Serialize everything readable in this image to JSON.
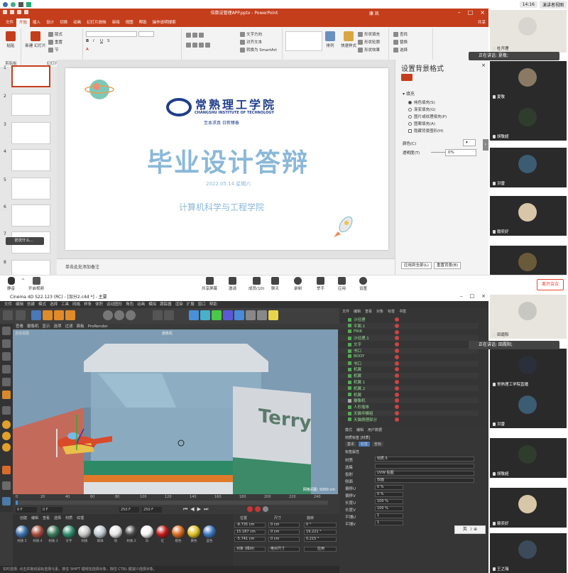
{
  "status": {
    "time": "14:16",
    "view_label": "演讲者视图"
  },
  "ppt": {
    "title": "倍数设管理APP.pptx - PowerPoint",
    "user": "康 凯",
    "tabs": [
      "文件",
      "开始",
      "插入",
      "设计",
      "切换",
      "动画",
      "幻灯片放映",
      "审阅",
      "视图",
      "帮助",
      "操作说明搜索"
    ],
    "active_tab": "开始",
    "share": "共享",
    "groups": [
      "剪贴板",
      "幻灯片",
      "字体",
      "段落",
      "绘图",
      "编辑"
    ],
    "ribbon_labels": {
      "paste": "粘贴",
      "new_slide": "新建\n幻灯片",
      "layout": "版式",
      "reset": "重置",
      "section": "节",
      "find": "查找",
      "replace": "替换",
      "select": "选择",
      "text_dir": "文字方向",
      "align": "对齐文本",
      "smartart": "转换为 SmartArt",
      "arrange": "排列",
      "quick_styles": "快速样式",
      "fill": "形状填充",
      "outline": "形状轮廓",
      "effects": "形状效果"
    },
    "slide_nums": [
      "1",
      "2",
      "3",
      "4",
      "5",
      "6",
      "7",
      "8"
    ],
    "search_pill": "说说什么...",
    "slide": {
      "school_cn": "常熟理工学院",
      "school_en": "CHANGSHU INSTITUTE OF TECHNOLOGY",
      "motto": "至本求真  日新臻善",
      "title": "毕业设计答辩",
      "date": "2022.05.14 星期六",
      "dept": "计算机科学与工程学院"
    },
    "notes": "单击此处添加备注",
    "format_pane": {
      "title": "设置背景格式",
      "section": "填充",
      "options": [
        "纯色填充(S)",
        "渐变填充(G)",
        "图片或纹理填充(P)",
        "图案填充(A)",
        "隐藏背景图形(H)"
      ],
      "color_label": "颜色(C)",
      "transparency_label": "透明度(T)",
      "transparency_value": "0%",
      "apply_all": "应用到全部(L)",
      "reset_bg": "重置背景(B)"
    }
  },
  "meeting": {
    "buttons": [
      "静音",
      "开启视频",
      "共享屏幕",
      "邀请",
      "成员(10)",
      "聊天",
      "录制",
      "举手",
      "应用",
      "设置"
    ],
    "leave": "离开会议"
  },
  "participants_top": [
    {
      "name": "杜开理",
      "color": "#d8d4cf"
    },
    {
      "name": "夏敬",
      "color": "#8a7a64"
    },
    {
      "name": "胡敬超",
      "color": "#2f3d2c"
    },
    {
      "name": "洪雷",
      "color": "#3b5c72"
    },
    {
      "name": "翰奕好",
      "color": "#d8c6a8"
    },
    {
      "name": "",
      "color": "#6a5a3a"
    }
  ],
  "speaking_top": "正在讲话: 夏敬;",
  "speaking_bottom": "正在讲话: 田霞阳;",
  "participants_bottom": [
    {
      "name": "田霞阳",
      "color": "#c9c7c2"
    },
    {
      "name": "常熟理工学院直播",
      "color": "#2b2f3a"
    },
    {
      "name": "洪雷",
      "color": "#3b5c72"
    },
    {
      "name": "胡敬超",
      "color": "#2f3d2c"
    },
    {
      "name": "赖奕好",
      "color": "#d8c6a8"
    },
    {
      "name": "王之瑞",
      "color": "#3c4a5a"
    }
  ],
  "c4d": {
    "title": "Cinema 4D S22.123 (RC) - [加分2.c4d *] - 主要",
    "menu": [
      "文件",
      "编辑",
      "创建",
      "模式",
      "选择",
      "工具",
      "网格",
      "样条",
      "体积",
      "运动图形",
      "角色",
      "动画",
      "模拟",
      "跟踪器",
      "渲染",
      "扩展",
      "窗口",
      "帮助"
    ],
    "vp_menu": [
      "查看",
      "摄像机",
      "显示",
      "选项",
      "过滤",
      "面板",
      "ProRender"
    ],
    "vp_label": "透视视图",
    "camera_label": "摄像机",
    "grid_label": "网格间距: 5000 cm",
    "sign": "Terry",
    "timeline_ticks": [
      "0",
      "20",
      "40",
      "60",
      "80",
      "100",
      "120",
      "140",
      "160",
      "180",
      "200",
      "220",
      "240"
    ],
    "frame_start": "0 F",
    "frame_end": "250 F",
    "mat_menu": [
      "创建",
      "编辑",
      "查看",
      "选择",
      "材质",
      "纹理"
    ],
    "materials": [
      "材质.5",
      "材质.4",
      "材质.3",
      "文字",
      "材质",
      "玻璃",
      "地",
      "材质.2",
      "白",
      "红",
      "橙色",
      "黄色",
      "蓝色"
    ],
    "mat_colors": [
      "#3a6ea8",
      "#a64a3a",
      "#3a7a5a",
      "#2e8e6e",
      "#c8c8c8",
      "#bfc9cf",
      "#e6e6e6",
      "#444",
      "#f5f5f5",
      "#c21818",
      "#d86a1a",
      "#e0c020",
      "#3a76c2"
    ],
    "coords": {
      "headers": [
        "位置",
        "尺寸",
        "旋转"
      ],
      "x": "-8.735 cm",
      "y": "15.187 cm",
      "z": "-5.741 cm",
      "sx": "0 cm",
      "sy": "0 cm",
      "sz": "0 cm",
      "h": "0 °",
      "p": "19.221 °",
      "b": "0.215 °",
      "mode": "对象 (相对)",
      "size_mode": "绝对尺寸",
      "apply": "应用"
    },
    "obj_tabs": [
      "文件",
      "编辑",
      "查看",
      "对象",
      "标签",
      "书签"
    ],
    "objects": [
      "沙径理",
      "平面.1",
      "FRIK",
      "沙径理.1",
      "文字",
      "书口",
      "BODY",
      "书口",
      "机翼",
      "机翼",
      "机翼.1",
      "机翼.2",
      "机翼",
      "摄像机",
      "人形摇体",
      "天猫坪模组",
      "天猫爬理部分"
    ],
    "attr_menu": [
      "模式",
      "编辑",
      "用户数据"
    ],
    "attr_obj": "材质标签 [材质]",
    "attr_tabs": [
      "基本",
      "标签",
      "坐标"
    ],
    "attr_title": "标签属性",
    "attr_rows": [
      [
        "材质",
        "材质.5"
      ],
      [
        "选集",
        ""
      ],
      [
        "投射",
        "UVW 贴图"
      ],
      [
        "侧面",
        "双面"
      ],
      [
        "偏移U",
        "0 %"
      ],
      [
        "偏移V",
        "0 %"
      ],
      [
        "长度U",
        "100 %"
      ],
      [
        "长度V",
        "100 %"
      ],
      [
        "平铺U",
        "1"
      ],
      [
        "平铺V",
        "1"
      ]
    ],
    "status": "实时选择: 点击并拖动鼠标选择元素。按住 SHIFT 键增加选择对象，按住 CTRL 键减少选择对象。"
  }
}
